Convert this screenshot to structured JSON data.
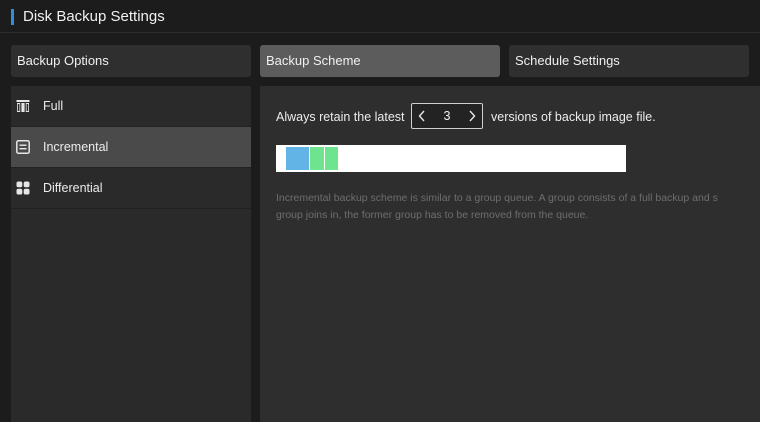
{
  "window": {
    "title": "Disk Backup Settings",
    "accent_color": "#2f8fde"
  },
  "tabs": [
    {
      "label": "Backup Options",
      "active": false
    },
    {
      "label": "Backup Scheme",
      "active": true
    },
    {
      "label": "Schedule Settings",
      "active": false
    }
  ],
  "sidebar": {
    "items": [
      {
        "label": "Full",
        "icon": "full-backup-icon",
        "active": false
      },
      {
        "label": "Incremental",
        "icon": "incremental-backup-icon",
        "active": true
      },
      {
        "label": "Differential",
        "icon": "differential-backup-icon",
        "active": false
      }
    ]
  },
  "scheme": {
    "retain_prefix": "Always retain the latest",
    "retain_count": "3",
    "retain_suffix": "versions of backup image file.",
    "prev_icon": "chevron-left-icon",
    "next_icon": "chevron-right-icon",
    "queue_blocks": [
      {
        "kind": "full",
        "color": "#63b4e6"
      },
      {
        "kind": "incremental",
        "color": "#6fe48e"
      },
      {
        "kind": "incremental",
        "color": "#6fe48e"
      }
    ],
    "description_line1": "Incremental backup scheme is similar to a group queue. A group consists of a full backup and s",
    "description_line2": "group joins in, the former group has to be removed from the queue."
  }
}
